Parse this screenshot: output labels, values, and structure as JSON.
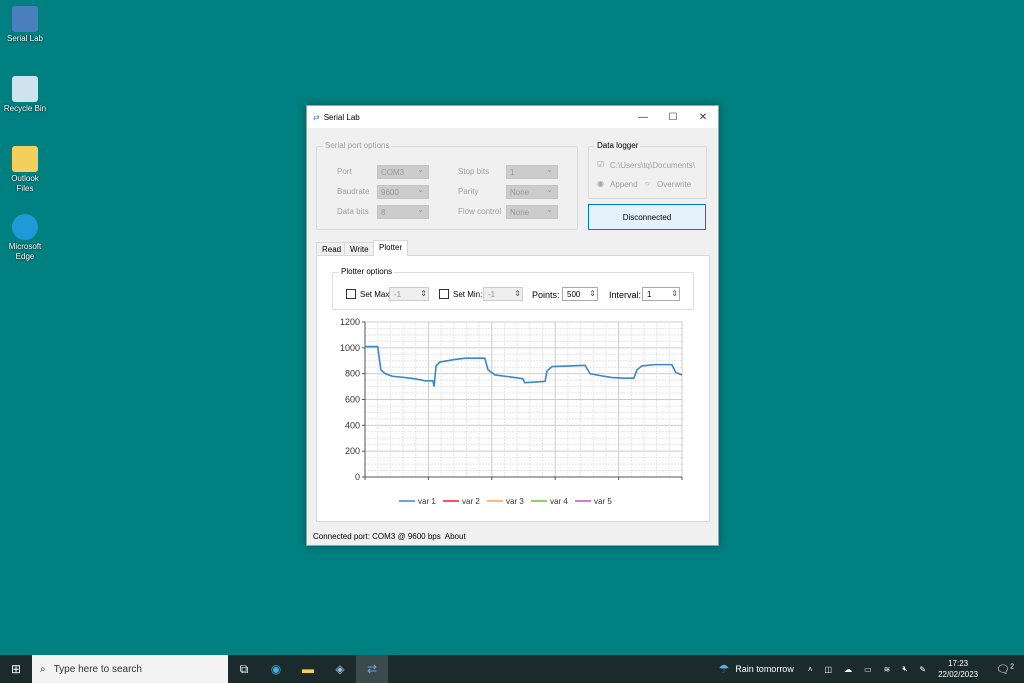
{
  "desktop": {
    "icons": [
      {
        "label": "Serial Lab"
      },
      {
        "label": "Recycle Bin"
      },
      {
        "label": "Outlook Files"
      },
      {
        "label": "Microsoft Edge"
      }
    ]
  },
  "window": {
    "title": "Serial Lab",
    "serial_options": {
      "legend": "Serial port options",
      "port_label": "Port",
      "port": "COM3",
      "baud_label": "Baudrate",
      "baud": "9600",
      "databits_label": "Data bits",
      "databits": "8",
      "stopbits_label": "Stop bits",
      "stopbits": "1",
      "parity_label": "Parity",
      "parity": "None",
      "flow_label": "Flow control",
      "flow": "None"
    },
    "logger": {
      "legend": "Data logger",
      "path": "C:\\Users\\tq\\Documents\\",
      "checked": true,
      "append": "Append",
      "overwrite": "Overwrite",
      "mode": "Append"
    },
    "connect_button": "Disconnected",
    "tabs": [
      {
        "label": "Read"
      },
      {
        "label": "Write"
      },
      {
        "label": "Plotter",
        "active": true
      }
    ],
    "plotter_options": {
      "legend": "Plotter options",
      "set_max": "Set Max:",
      "max_value": "-1",
      "set_min": "Set Min:",
      "min_value": "-1",
      "points_label": "Points:",
      "points": "500",
      "interval_label": "Interval:",
      "interval": "1"
    },
    "status": {
      "text": "Connected port: COM3 @ 9600 bps",
      "about": "About"
    }
  },
  "chart_data": {
    "type": "line",
    "ylim": [
      0,
      1200
    ],
    "xlim": [
      0,
      500
    ],
    "yticks": [
      "0",
      "200",
      "400",
      "600",
      "800",
      "1000",
      "1200"
    ],
    "grid": true,
    "legend_placement": "bottom",
    "series": [
      {
        "name": "var 1",
        "color": "#3a87c8",
        "points": [
          [
            0,
            1010
          ],
          [
            20,
            1010
          ],
          [
            25,
            830
          ],
          [
            32,
            800
          ],
          [
            43,
            780
          ],
          [
            63,
            770
          ],
          [
            79,
            760
          ],
          [
            95,
            745
          ],
          [
            107,
            745
          ],
          [
            109,
            700
          ],
          [
            112,
            860
          ],
          [
            118,
            890
          ],
          [
            142,
            910
          ],
          [
            158,
            920
          ],
          [
            189,
            920
          ],
          [
            194,
            830
          ],
          [
            205,
            790
          ],
          [
            229,
            775
          ],
          [
            244,
            765
          ],
          [
            249,
            760
          ],
          [
            252,
            730
          ],
          [
            268,
            735
          ],
          [
            284,
            740
          ],
          [
            287,
            820
          ],
          [
            295,
            855
          ],
          [
            323,
            860
          ],
          [
            347,
            865
          ],
          [
            355,
            800
          ],
          [
            371,
            785
          ],
          [
            390,
            770
          ],
          [
            410,
            765
          ],
          [
            424,
            765
          ],
          [
            429,
            830
          ],
          [
            437,
            860
          ],
          [
            457,
            870
          ],
          [
            484,
            870
          ],
          [
            490,
            810
          ],
          [
            500,
            790
          ]
        ]
      },
      {
        "name": "var 2",
        "color": "#e8202a",
        "points": []
      },
      {
        "name": "var 3",
        "color": "#f5a54a",
        "points": []
      },
      {
        "name": "var 4",
        "color": "#6cbf3a",
        "points": []
      },
      {
        "name": "var 5",
        "color": "#c050c0",
        "points": []
      }
    ]
  },
  "taskbar": {
    "search_placeholder": "Type here to search",
    "weather": "Rain tomorrow",
    "time": "17:23",
    "date": "22/02/2023",
    "notifications": "2"
  }
}
